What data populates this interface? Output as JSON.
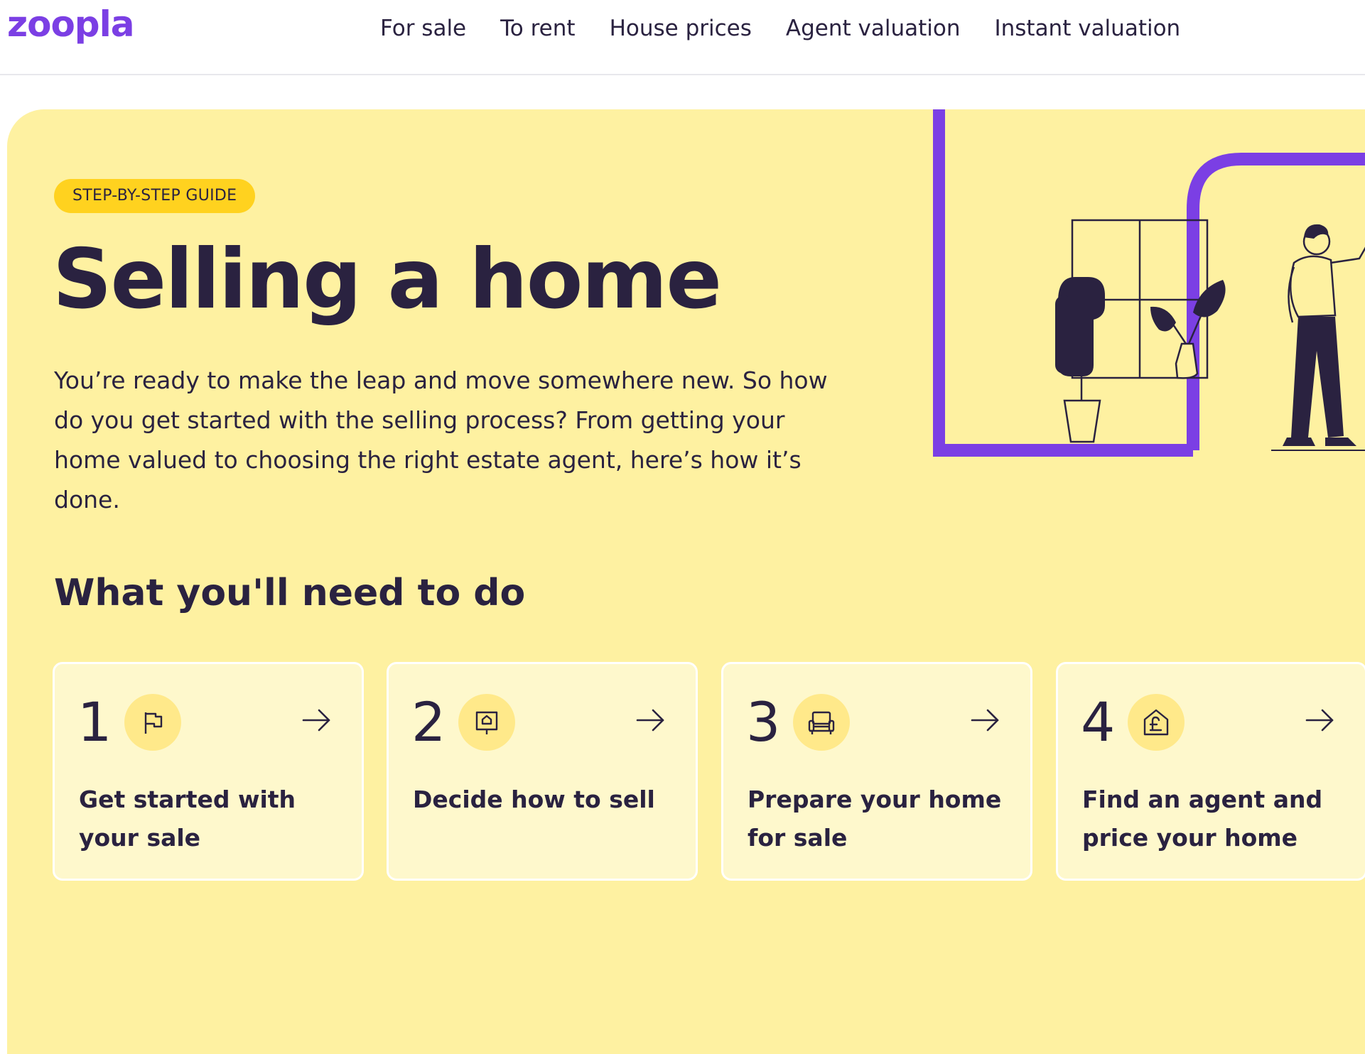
{
  "header": {
    "logo": "zoopla",
    "nav": [
      {
        "label": "For sale"
      },
      {
        "label": "To rent"
      },
      {
        "label": "House prices"
      },
      {
        "label": "Agent valuation"
      },
      {
        "label": "Instant valuation"
      }
    ]
  },
  "hero": {
    "badge": "STEP-BY-STEP GUIDE",
    "title": "Selling a home",
    "intro": "You’re ready to make the leap and move somewhere new. So how do you get started with the selling process? From getting your home valued to choosing the right estate agent, here’s how it’s done.",
    "section_title": "What you'll need to do"
  },
  "steps": [
    {
      "number": "1",
      "icon": "flag-icon",
      "label": "Get started with your sale"
    },
    {
      "number": "2",
      "icon": "for-sale-sign-icon",
      "label": "Decide how to sell"
    },
    {
      "number": "3",
      "icon": "armchair-icon",
      "label": "Prepare your home for sale"
    },
    {
      "number": "4",
      "icon": "house-pound-icon",
      "label": "Find an agent and price your home"
    }
  ],
  "colors": {
    "brand": "#7b3fe4",
    "hero_bg": "#fef1a1",
    "badge_bg": "#ffd21f",
    "text": "#2a2240",
    "card_bg": "#fef8cc",
    "icon_circle": "#ffe98a"
  }
}
